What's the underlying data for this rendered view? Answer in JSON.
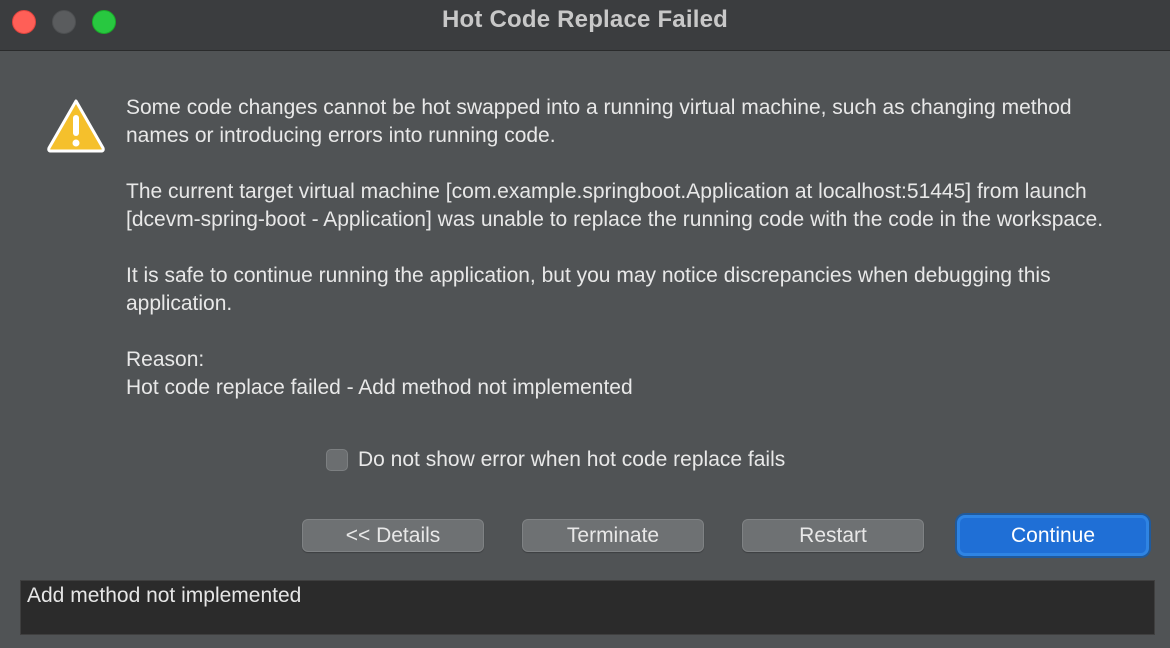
{
  "window": {
    "title": "Hot Code Replace Failed"
  },
  "icons": {
    "warning": "warning-triangle-icon"
  },
  "message": {
    "paragraph1": "Some code changes cannot be hot swapped into a running virtual machine, such as changing method names or introducing errors into running code.",
    "paragraph2": "The current target virtual machine [com.example.springboot.Application at localhost:51445] from launch [dcevm-spring-boot - Application] was unable to replace the running code with the code in the workspace.",
    "paragraph3": "It is safe to continue running the application, but you may notice discrepancies when debugging this application.",
    "reason_label": "Reason:",
    "reason_text": "Hot code replace failed - Add method not implemented"
  },
  "checkbox": {
    "label": "Do not show error when hot code replace fails",
    "checked": false
  },
  "buttons": {
    "details": "<< Details",
    "terminate": "Terminate",
    "restart": "Restart",
    "continue": "Continue"
  },
  "details": {
    "text": "Add method not implemented"
  },
  "colors": {
    "accent": "#1f6fd6",
    "background": "#505355",
    "close": "#ff5f57",
    "maximize": "#28c840",
    "warning": "#f5c02c"
  }
}
